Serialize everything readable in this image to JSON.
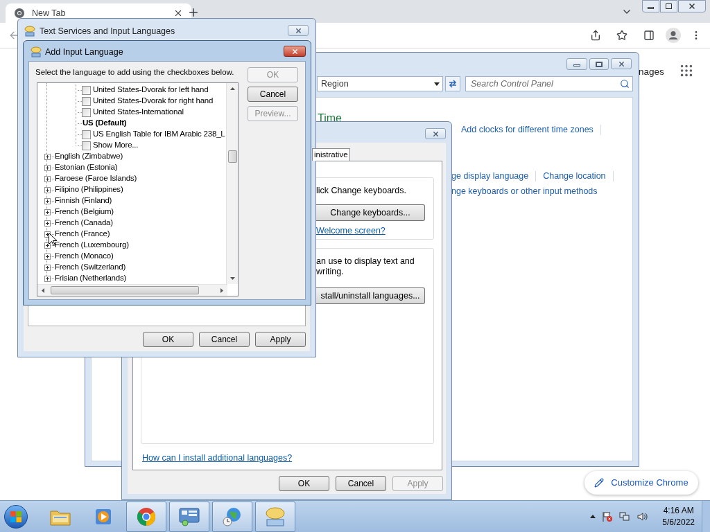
{
  "browser": {
    "tab_title": "New Tab",
    "page_link_partial": "nages",
    "customize_button": "Customize Chrome"
  },
  "control_panel": {
    "address": "Region",
    "search_placeholder": "Search Control Panel",
    "heading": "Time",
    "link_rows": [
      [
        "Add clocks for different time zones"
      ],
      [
        "ge display language",
        "Change location"
      ],
      [
        "nge keyboards or other input methods"
      ]
    ]
  },
  "region_dialog": {
    "tabs": [
      {
        "label": "inistrative",
        "selected": true
      }
    ],
    "groups": [
      {
        "lines": [
          "lick Change keyboards."
        ],
        "button": "Change keyboards...",
        "link": "Welcome screen?"
      },
      {
        "lines": [
          "an use to display text and",
          "writing."
        ],
        "button": "stall/uninstall languages..."
      }
    ],
    "help_link": "How can I install additional languages?",
    "buttons": [
      {
        "label": "OK",
        "disabled": false
      },
      {
        "label": "Cancel",
        "disabled": false
      },
      {
        "label": "Apply",
        "disabled": true
      }
    ]
  },
  "text_services": {
    "title": "Text Services and Input Languages",
    "buttons": [
      {
        "label": "OK",
        "disabled": false
      },
      {
        "label": "Cancel",
        "disabled": false
      },
      {
        "label": "Apply",
        "disabled": false
      }
    ]
  },
  "add_language": {
    "title": "Add Input Language",
    "instruction": "Select the language to add using the checkboxes below.",
    "buttons": [
      {
        "label": "OK",
        "disabled": true
      },
      {
        "label": "Cancel",
        "disabled": false
      },
      {
        "label": "Preview...",
        "disabled": true
      }
    ],
    "tree": [
      {
        "children": [
          {
            "children": [
              {
                "label": "United States-Dvorak for left hand",
                "kind": "checkbox",
                "checked": false
              },
              {
                "label": "United States-Dvorak for right hand",
                "kind": "checkbox",
                "checked": false
              },
              {
                "label": "United States-International",
                "kind": "checkbox",
                "checked": false
              },
              {
                "label": "US (Default)",
                "kind": "default"
              },
              {
                "label": "US English Table for IBM Arabic 238_L",
                "kind": "checkbox",
                "checked": false
              },
              {
                "label": "Show More...",
                "kind": "checkbox",
                "checked": false
              }
            ]
          }
        ]
      },
      {
        "label": "English (Zimbabwe)",
        "kind": "group",
        "expanded": false
      },
      {
        "label": "Estonian (Estonia)",
        "kind": "group",
        "expanded": false
      },
      {
        "label": "Faroese (Faroe Islands)",
        "kind": "group",
        "expanded": false
      },
      {
        "label": "Filipino (Philippines)",
        "kind": "group",
        "expanded": false
      },
      {
        "label": "Finnish (Finland)",
        "kind": "group",
        "expanded": false
      },
      {
        "label": "French (Belgium)",
        "kind": "group",
        "expanded": false
      },
      {
        "label": "French (Canada)",
        "kind": "group",
        "expanded": false
      },
      {
        "label": "French (France)",
        "kind": "group",
        "expanded": false
      },
      {
        "label": "French (Luxembourg)",
        "kind": "group",
        "expanded": false
      },
      {
        "label": "French (Monaco)",
        "kind": "group",
        "expanded": false
      },
      {
        "label": "French (Switzerland)",
        "kind": "group",
        "expanded": false
      },
      {
        "label": "Frisian (Netherlands)",
        "kind": "group",
        "expanded": false
      }
    ]
  },
  "taskbar": {
    "items": [
      {
        "kind": "explorer",
        "open": false
      },
      {
        "kind": "media",
        "open": false
      },
      {
        "kind": "chrome",
        "open": true
      },
      {
        "kind": "control",
        "open": true
      },
      {
        "kind": "globe",
        "open": true
      },
      {
        "kind": "keyboard",
        "open": true
      }
    ],
    "time": "4:16 AM",
    "date": "5/6/2022"
  }
}
